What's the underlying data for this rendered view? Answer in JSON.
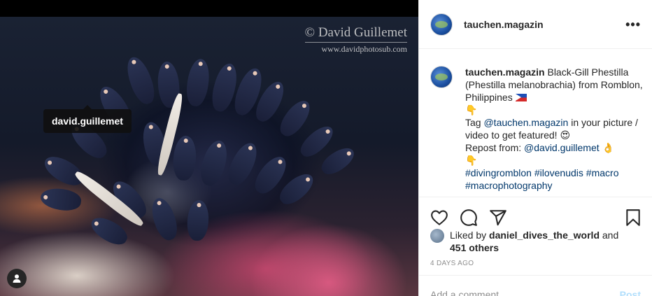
{
  "photo": {
    "watermark_name": "© David Guillemet",
    "watermark_url": "www.davidphotosub.com",
    "tag_label": "david.guillemet"
  },
  "header": {
    "username": "tauchen.magazin",
    "more_icon": "more-icon"
  },
  "caption": {
    "username": "tauchen.magazin",
    "title_line": "Black-Gill Phestilla (Phestilla melanobrachia) from Romblon, Philippines",
    "pointing_down_emoji": "👇",
    "tag_prefix": "Tag ",
    "tag_mention": "@tauchen.magazin",
    "tag_suffix": " in your picture / video to get featured! ",
    "heart_eyes_emoji": "😍",
    "repost_prefix": "Repost from: ",
    "repost_mention": "@david.guillemet",
    "ok_hand_emoji": "👌",
    "pointing_down_emoji_2": "👇",
    "hashtags": [
      "#divingromblon",
      "#ilovenudis",
      "#macro",
      "#macrophotography"
    ]
  },
  "actions": {
    "like_icon": "heart-icon",
    "comment_icon": "comment-icon",
    "share_icon": "share-icon",
    "save_icon": "bookmark-icon"
  },
  "likes": {
    "prefix": "Liked by ",
    "user": "daniel_dives_the_world",
    "middle": " and",
    "others": "451 others"
  },
  "timestamp": "4 days ago",
  "comment": {
    "placeholder": "Add a comment…",
    "post_label": "Post"
  }
}
